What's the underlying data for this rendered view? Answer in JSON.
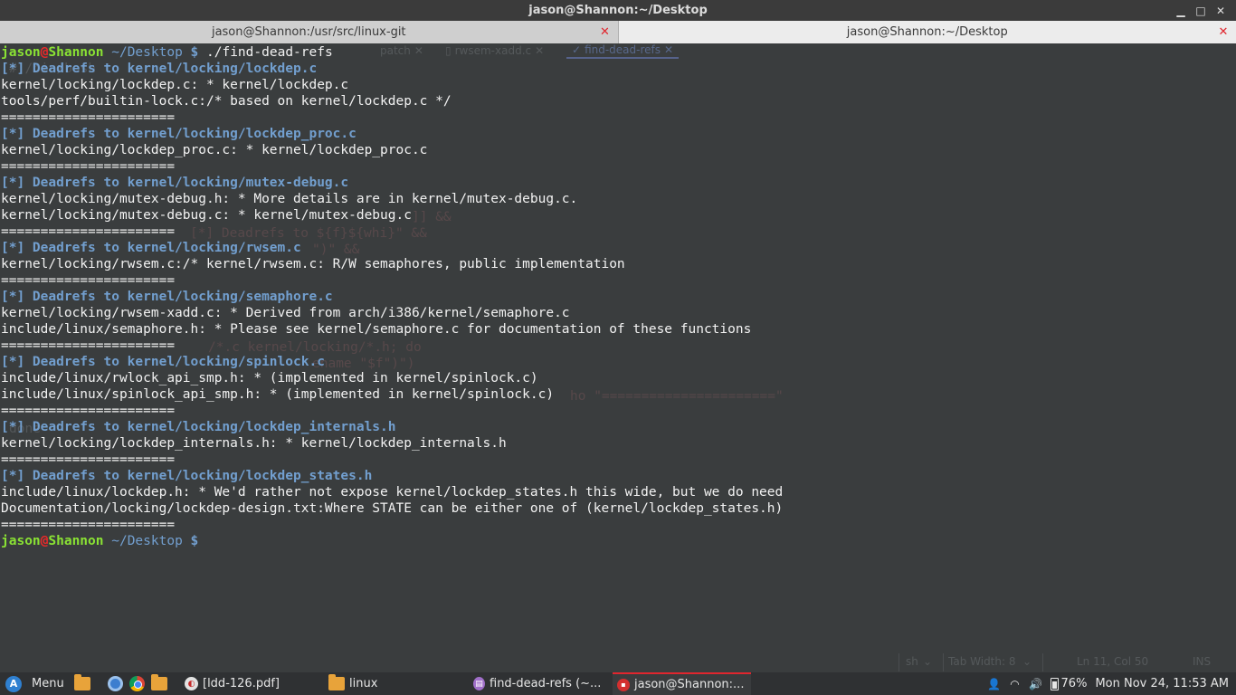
{
  "window": {
    "title": "jason@Shannon:~/Desktop",
    "controls": {
      "minimize": "▁",
      "maximize": "□",
      "close": "✕"
    }
  },
  "terminal_tabs": [
    {
      "label": "jason@Shannon:/usr/src/linux-git",
      "close": "✕",
      "active": false
    },
    {
      "label": "jason@Shannon:~/Desktop",
      "close": "✕",
      "active": true
    }
  ],
  "prompt": {
    "user": "jason",
    "at": "@",
    "host": "Shannon",
    "dir": "~/Desktop",
    "dollar": "$"
  },
  "command": "./find-dead-refs",
  "output": {
    "separator": "======================",
    "blocks": [
      {
        "header": "[*] Deadrefs to kernel/locking/lockdep.c",
        "lines": [
          "kernel/locking/lockdep.c: * kernel/lockdep.c",
          "tools/perf/builtin-lock.c:/* based on kernel/lockdep.c */"
        ]
      },
      {
        "header": "[*] Deadrefs to kernel/locking/lockdep_proc.c",
        "lines": [
          "kernel/locking/lockdep_proc.c: * kernel/lockdep_proc.c"
        ]
      },
      {
        "header": "[*] Deadrefs to kernel/locking/mutex-debug.c",
        "lines": [
          "kernel/locking/mutex-debug.h: * More details are in kernel/mutex-debug.c.",
          "kernel/locking/mutex-debug.c: * kernel/mutex-debug.c"
        ]
      },
      {
        "header": "[*] Deadrefs to kernel/locking/rwsem.c",
        "lines": [
          "kernel/locking/rwsem.c:/* kernel/rwsem.c: R/W semaphores, public implementation"
        ]
      },
      {
        "header": "[*] Deadrefs to kernel/locking/semaphore.c",
        "lines": [
          "kernel/locking/rwsem-xadd.c: * Derived from arch/i386/kernel/semaphore.c",
          "include/linux/semaphore.h: * Please see kernel/semaphore.c for documentation of these functions"
        ]
      },
      {
        "header": "[*] Deadrefs to kernel/locking/spinlock.c",
        "lines": [
          "include/linux/rwlock_api_smp.h: * (implemented in kernel/spinlock.c)",
          "include/linux/spinlock_api_smp.h: * (implemented in kernel/spinlock.c)"
        ]
      },
      {
        "header": "[*] Deadrefs to kernel/locking/lockdep_internals.h",
        "lines": [
          "kernel/locking/lockdep_internals.h: * kernel/lockdep_internals.h"
        ]
      },
      {
        "header": "[*] Deadrefs to kernel/locking/lockdep_states.h",
        "lines": [
          "include/linux/lockdep.h: * We'd rather not expose kernel/lockdep_states.h this wide, but we do need",
          "Documentation/locking/lockdep-design.txt:Where STATE can be either one of (kernel/lockdep_states.h)"
        ]
      }
    ]
  },
  "background_editor": {
    "tabs": [
      "patch",
      "rwsem-xadd.c",
      "find-dead-refs"
    ],
    "status": {
      "language": "sh",
      "tab_width": "Tab Width: 8",
      "position": "Ln 11, Col 50",
      "mode": "INS"
    }
  },
  "taskbar": {
    "menu_label": "Menu",
    "windows": [
      {
        "label": "[ldd-126.pdf]",
        "icon": "pdf-icon"
      },
      {
        "label": "linux",
        "icon": "folder-icon"
      },
      {
        "label": "find-dead-refs (~...",
        "icon": "text-editor-icon"
      },
      {
        "label": "jason@Shannon:...",
        "icon": "terminal-icon"
      }
    ],
    "battery": "76%",
    "clock": "Mon Nov 24, 11:53 AM"
  }
}
